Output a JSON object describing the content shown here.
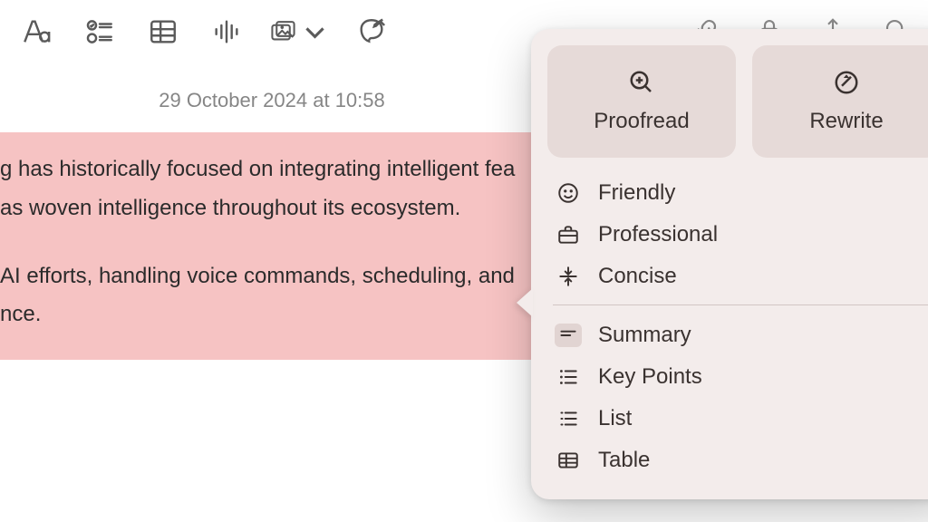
{
  "dateline": "29 October 2024 at 10:58",
  "note_body": {
    "line1": "g has historically focused on integrating intelligent fea",
    "line2": "as woven intelligence throughout its ecosystem.",
    "line3": "AI efforts, handling voice commands, scheduling, and",
    "line4": "nce."
  },
  "ai_panel": {
    "proofread": "Proofread",
    "rewrite": "Rewrite",
    "tones": {
      "friendly": "Friendly",
      "professional": "Professional",
      "concise": "Concise"
    },
    "transforms": {
      "summary": "Summary",
      "key_points": "Key Points",
      "list": "List",
      "table": "Table"
    }
  }
}
